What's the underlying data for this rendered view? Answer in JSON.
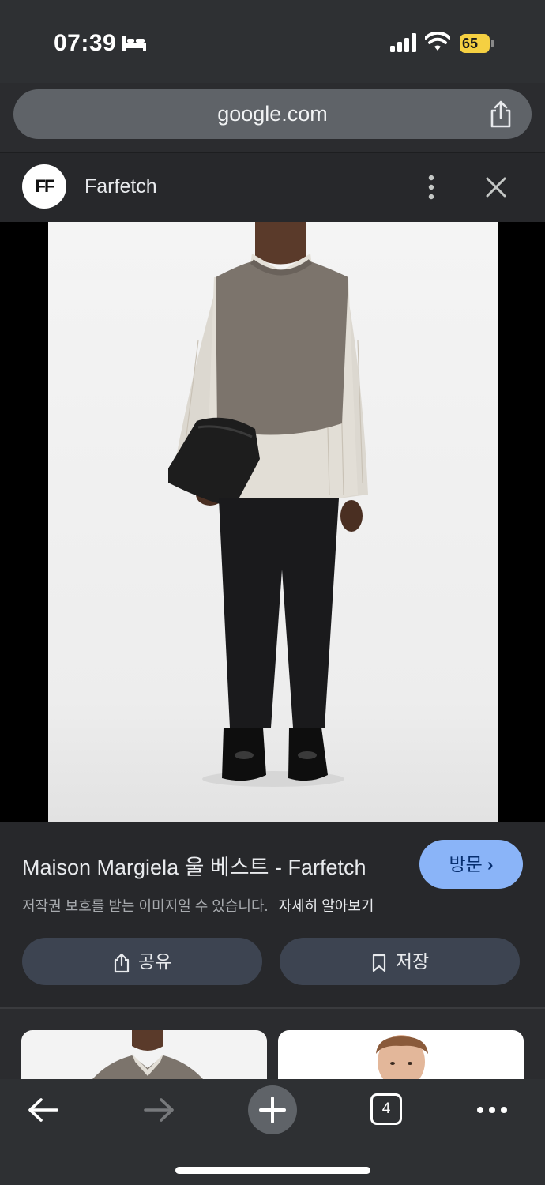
{
  "status_bar": {
    "time": "07:39",
    "battery_level": "65",
    "icons": [
      "bed-icon",
      "signal-icon",
      "wifi-icon",
      "battery-charging-icon"
    ]
  },
  "address_bar": {
    "url": "google.com",
    "share_icon": "share-icon"
  },
  "site": {
    "logo_text": "FF",
    "name": "Farfetch"
  },
  "image": {
    "alt": "Maison Margiela 울 베스트 - Farfetch"
  },
  "info": {
    "title": "Maison Margiela 울 베스트 - Farfetch",
    "visit_label": "방문",
    "visit_chevron": "›",
    "copyright_notice": "저작권 보호를 받는 이미지일 수 있습니다.",
    "learn_more": "자세히 알아보기",
    "share_label": "공유",
    "save_label": "저장"
  },
  "toolbar": {
    "tab_count": "4",
    "icons": [
      "back-arrow-icon",
      "forward-arrow-icon",
      "plus-icon",
      "tab-switcher-icon",
      "more-icon"
    ]
  },
  "colors": {
    "background": "#27282b",
    "accent": "#8ab4f8",
    "button_bg": "#3d4451",
    "battery": "#f5d042"
  }
}
